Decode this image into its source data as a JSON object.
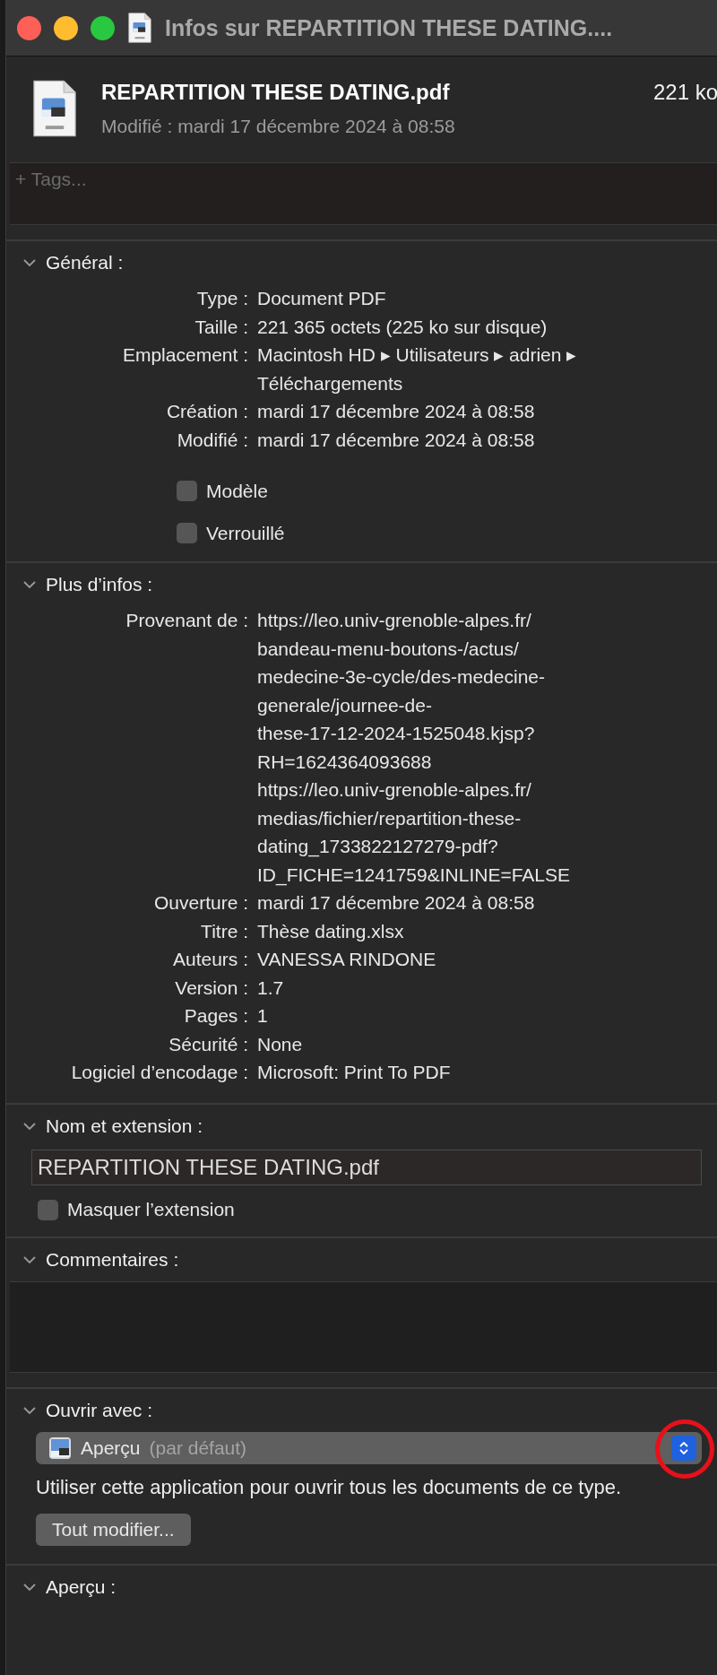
{
  "window": {
    "title": "Infos sur REPARTITION THESE DATING...."
  },
  "file": {
    "name": "REPARTITION THESE DATING.pdf",
    "size": "221 ko",
    "modified": "Modifié : mardi 17 décembre 2024 à 08:58"
  },
  "tags": {
    "placeholder": "+ Tags..."
  },
  "general": {
    "title": "Général :",
    "expanded": true,
    "rows": [
      {
        "label": "Type :",
        "lines": [
          "Document PDF"
        ]
      },
      {
        "label": "Taille :",
        "lines": [
          "221 365 octets (225 ko sur disque)"
        ]
      },
      {
        "label": "Emplacement :",
        "lines": [
          "Macintosh HD ▸ Utilisateurs ▸ adrien ▸",
          "Téléchargements"
        ]
      },
      {
        "label": "Création :",
        "lines": [
          "mardi 17 décembre 2024 à 08:58"
        ]
      },
      {
        "label": "Modifié :",
        "lines": [
          "mardi 17 décembre 2024 à 08:58"
        ]
      }
    ],
    "checkboxes": [
      {
        "label": "Modèle",
        "checked": false
      },
      {
        "label": "Verrouillé",
        "checked": false
      }
    ]
  },
  "more_info": {
    "title": "Plus d’infos :",
    "expanded": true,
    "rows": [
      {
        "label": "Provenant de :",
        "lines": [
          "https://leo.univ-grenoble-alpes.fr/",
          "bandeau-menu-boutons-/actus/",
          "medecine-3e-cycle/des-medecine-",
          "generale/journee-de-",
          "these-17-12-2024-1525048.kjsp?",
          "RH=1624364093688",
          "https://leo.univ-grenoble-alpes.fr/",
          "medias/fichier/repartition-these-",
          "dating_1733822127279-pdf?",
          "ID_FICHE=1241759&INLINE=FALSE"
        ]
      },
      {
        "label": "Ouverture :",
        "lines": [
          "mardi 17 décembre 2024 à 08:58"
        ]
      },
      {
        "label": "Titre :",
        "lines": [
          "Thèse dating.xlsx"
        ]
      },
      {
        "label": "Auteurs :",
        "lines": [
          "VANESSA RINDONE"
        ]
      },
      {
        "label": "Version :",
        "lines": [
          "1.7"
        ]
      },
      {
        "label": "Pages :",
        "lines": [
          "1"
        ]
      },
      {
        "label": "Sécurité :",
        "lines": [
          "None"
        ]
      },
      {
        "label": "Logiciel d’encodage :",
        "lines": [
          "Microsoft: Print To PDF"
        ]
      }
    ]
  },
  "name_extension": {
    "title": "Nom et extension :",
    "expanded": true,
    "value": "REPARTITION THESE DATING.pdf",
    "checkbox": {
      "label": "Masquer l’extension",
      "checked": false
    }
  },
  "comments": {
    "title": "Commentaires :",
    "expanded": true
  },
  "open_with": {
    "title": "Ouvrir avec :",
    "expanded": true,
    "app": "Aperçu",
    "app_note": "(par défaut)",
    "description": "Utiliser cette application pour ouvrir tous les documents de ce type.",
    "button": "Tout modifier..."
  },
  "preview": {
    "title": "Aperçu :",
    "expanded": true
  }
}
